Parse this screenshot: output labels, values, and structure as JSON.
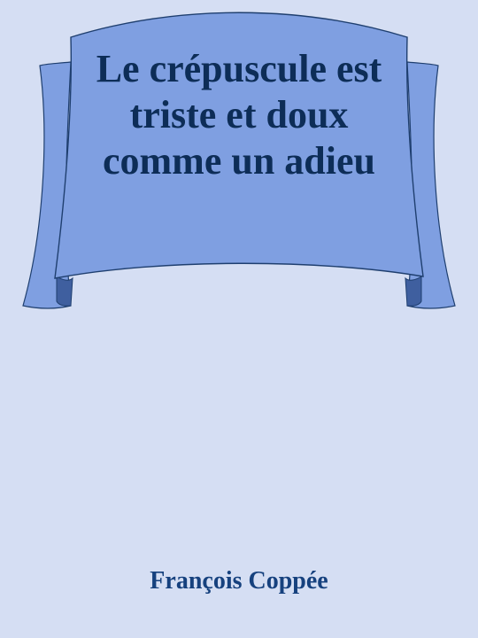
{
  "book": {
    "title": "Le crépuscule est triste et doux comme un adieu",
    "author": "François Coppée"
  },
  "colors": {
    "background": "#d5def3",
    "banner_fill": "#7f9fe1",
    "banner_shadow": "#3f5f9f",
    "banner_outline": "#1f3f6f",
    "title_text": "#0d2d57",
    "author_text": "#16417e"
  }
}
